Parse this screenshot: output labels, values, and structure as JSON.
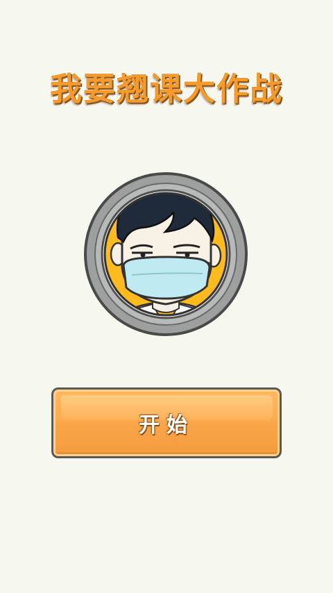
{
  "game": {
    "title": "我要翘课大作战",
    "start_label": "开始",
    "avatar_icon": "masked-student-face-icon"
  },
  "colors": {
    "background": "#f6f8ef",
    "title_orange": "#f49b2c",
    "button_orange": "#ffad51",
    "avatar_ring": "#9ea0a0",
    "avatar_inner": "#ffbb1c",
    "mask_blue": "#bfeaf2",
    "hair_navy": "#1f2b3a"
  }
}
